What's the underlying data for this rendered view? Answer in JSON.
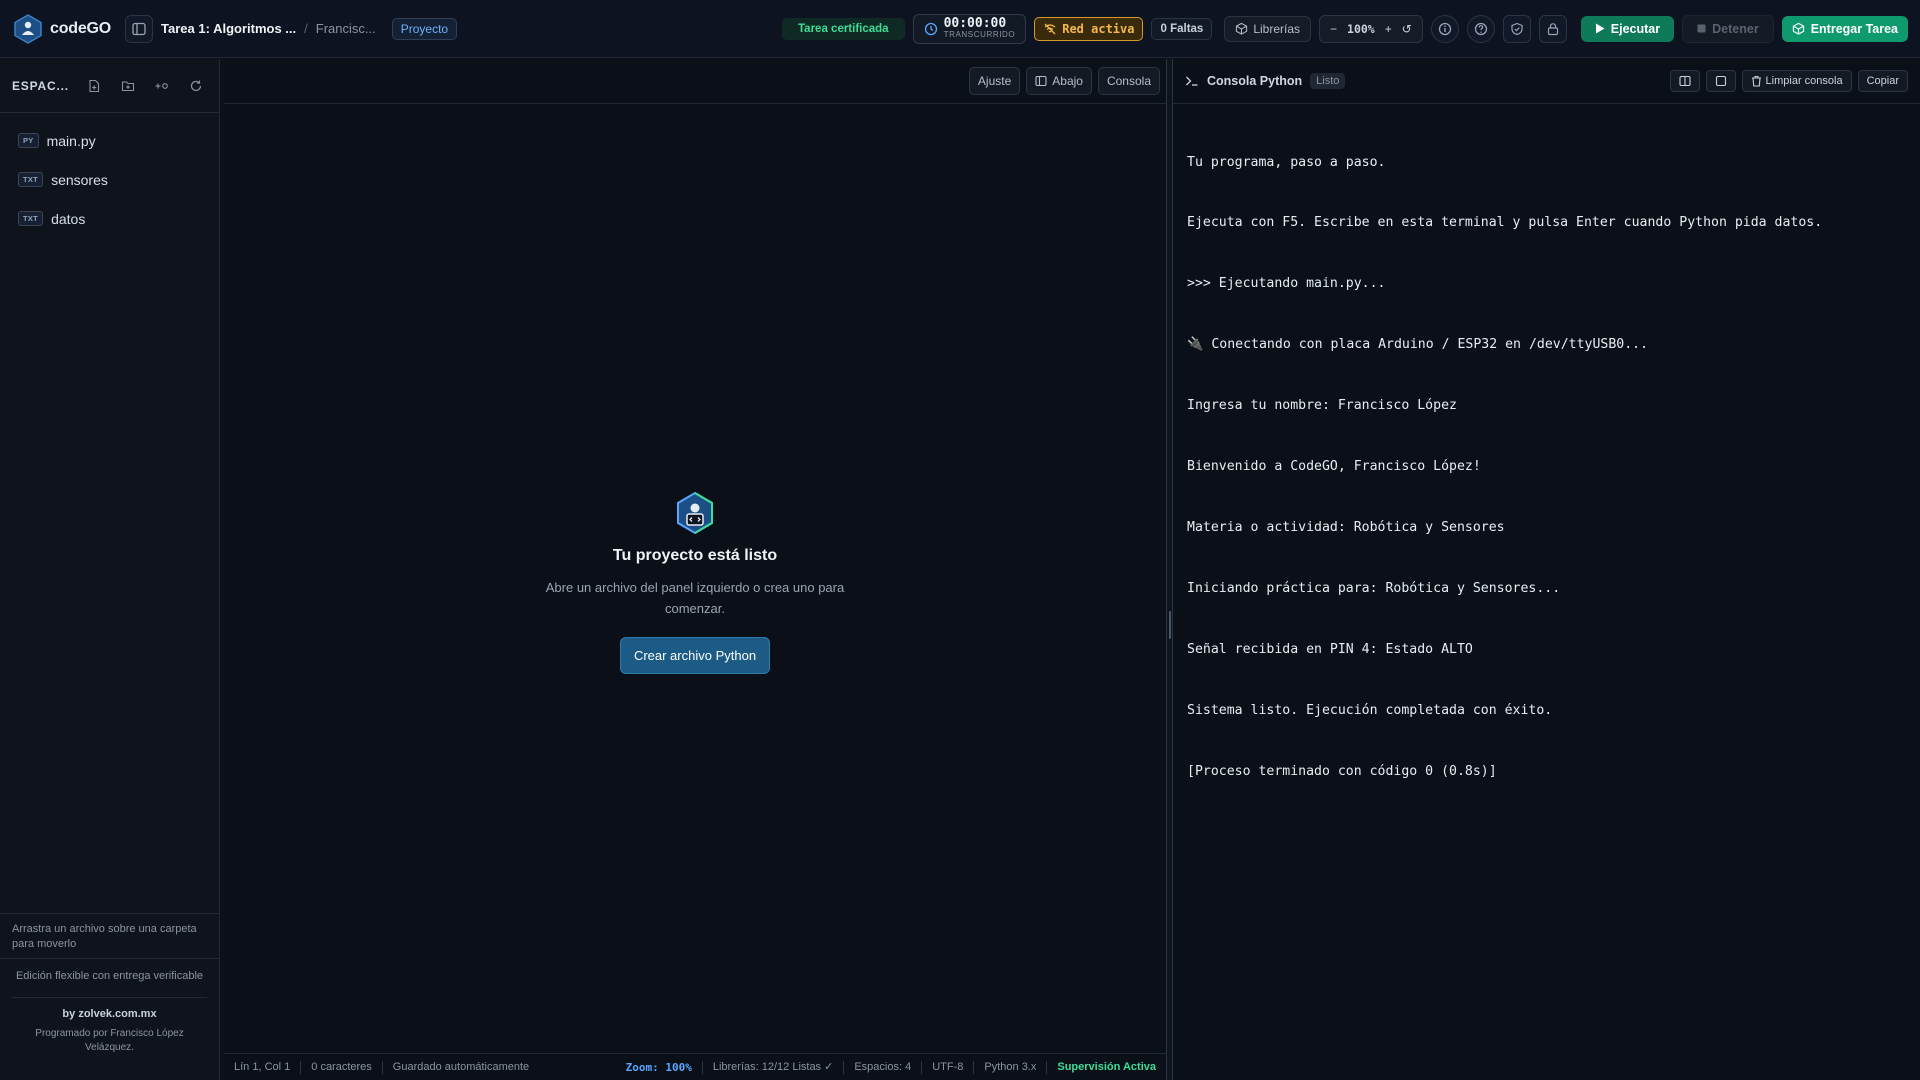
{
  "app": {
    "name": "codeGO",
    "brand_color": "#0f9a6e",
    "accent": "#58a6ff"
  },
  "header": {
    "title": "Tarea 1: Algoritmos ...",
    "breadcrumb_sep": "/",
    "user": "Francisc...",
    "mode_label": "Proyecto",
    "certified_label": "Tarea certificada",
    "timer_value": "00:00:00",
    "timer_label": "TRANSCURRIDO",
    "network_label": "Red activa",
    "faltas_label": "0 Faltas",
    "libraries_label": "Librerías",
    "zoom_minus": "−",
    "zoom_value": "100%",
    "zoom_plus": "+",
    "zoom_reset": "↺",
    "run_label": "Ejecutar",
    "stop_label": "Detener",
    "submit_label": "Entregar Tarea"
  },
  "sidebar": {
    "title": "ESPAC...",
    "files": [
      {
        "tag": "PY",
        "name": "main.py"
      },
      {
        "tag": "TXT",
        "name": "sensores"
      },
      {
        "tag": "TXT",
        "name": "datos"
      }
    ],
    "drag_hint": "Arrastra un archivo sobre una carpeta para moverlo",
    "footer_note": "Edición flexible con entrega verificable",
    "by": "by zolvek.com.mx",
    "credits": "Programado por Francisco López Velázquez."
  },
  "editor": {
    "toolbar": {
      "wrap_label": "Ajuste",
      "below_label": "Abajo",
      "console_label": "Consola"
    },
    "empty": {
      "title": "Tu proyecto está listo",
      "subtitle": "Abre un archivo del panel izquierdo o crea uno para comenzar.",
      "button": "Crear archivo Python"
    },
    "status": {
      "position": "Lín 1, Col 1",
      "chars": "0 caracteres",
      "autosave": "Guardado automáticamente",
      "zoom": "Zoom: 100%",
      "libraries": "Librerías: 12/12 Listas ✓",
      "spaces": "Espacios: 4",
      "encoding": "UTF-8",
      "python": "Python 3.x",
      "supervision": "Supervisión Activa"
    }
  },
  "console": {
    "title": "Consola Python",
    "badge": "Listo",
    "clear_label": "Limpiar consola",
    "copy_label": "Copiar",
    "lines": [
      "Tu programa, paso a paso.",
      "Ejecuta con F5. Escribe en esta terminal y pulsa Enter cuando Python pida datos.",
      ">>> Ejecutando main.py...",
      "🔌 Conectando con placa Arduino / ESP32 en /dev/ttyUSB0...",
      "Ingresa tu nombre: Francisco López",
      "Bienvenido a CodeGO, Francisco López!",
      "Materia o actividad: Robótica y Sensores",
      "Iniciando práctica para: Robótica y Sensores...",
      "Señal recibida en PIN 4: Estado ALTO",
      "Sistema listo. Ejecución completada con éxito.",
      "[Proceso terminado con código 0 (0.8s)]"
    ]
  }
}
